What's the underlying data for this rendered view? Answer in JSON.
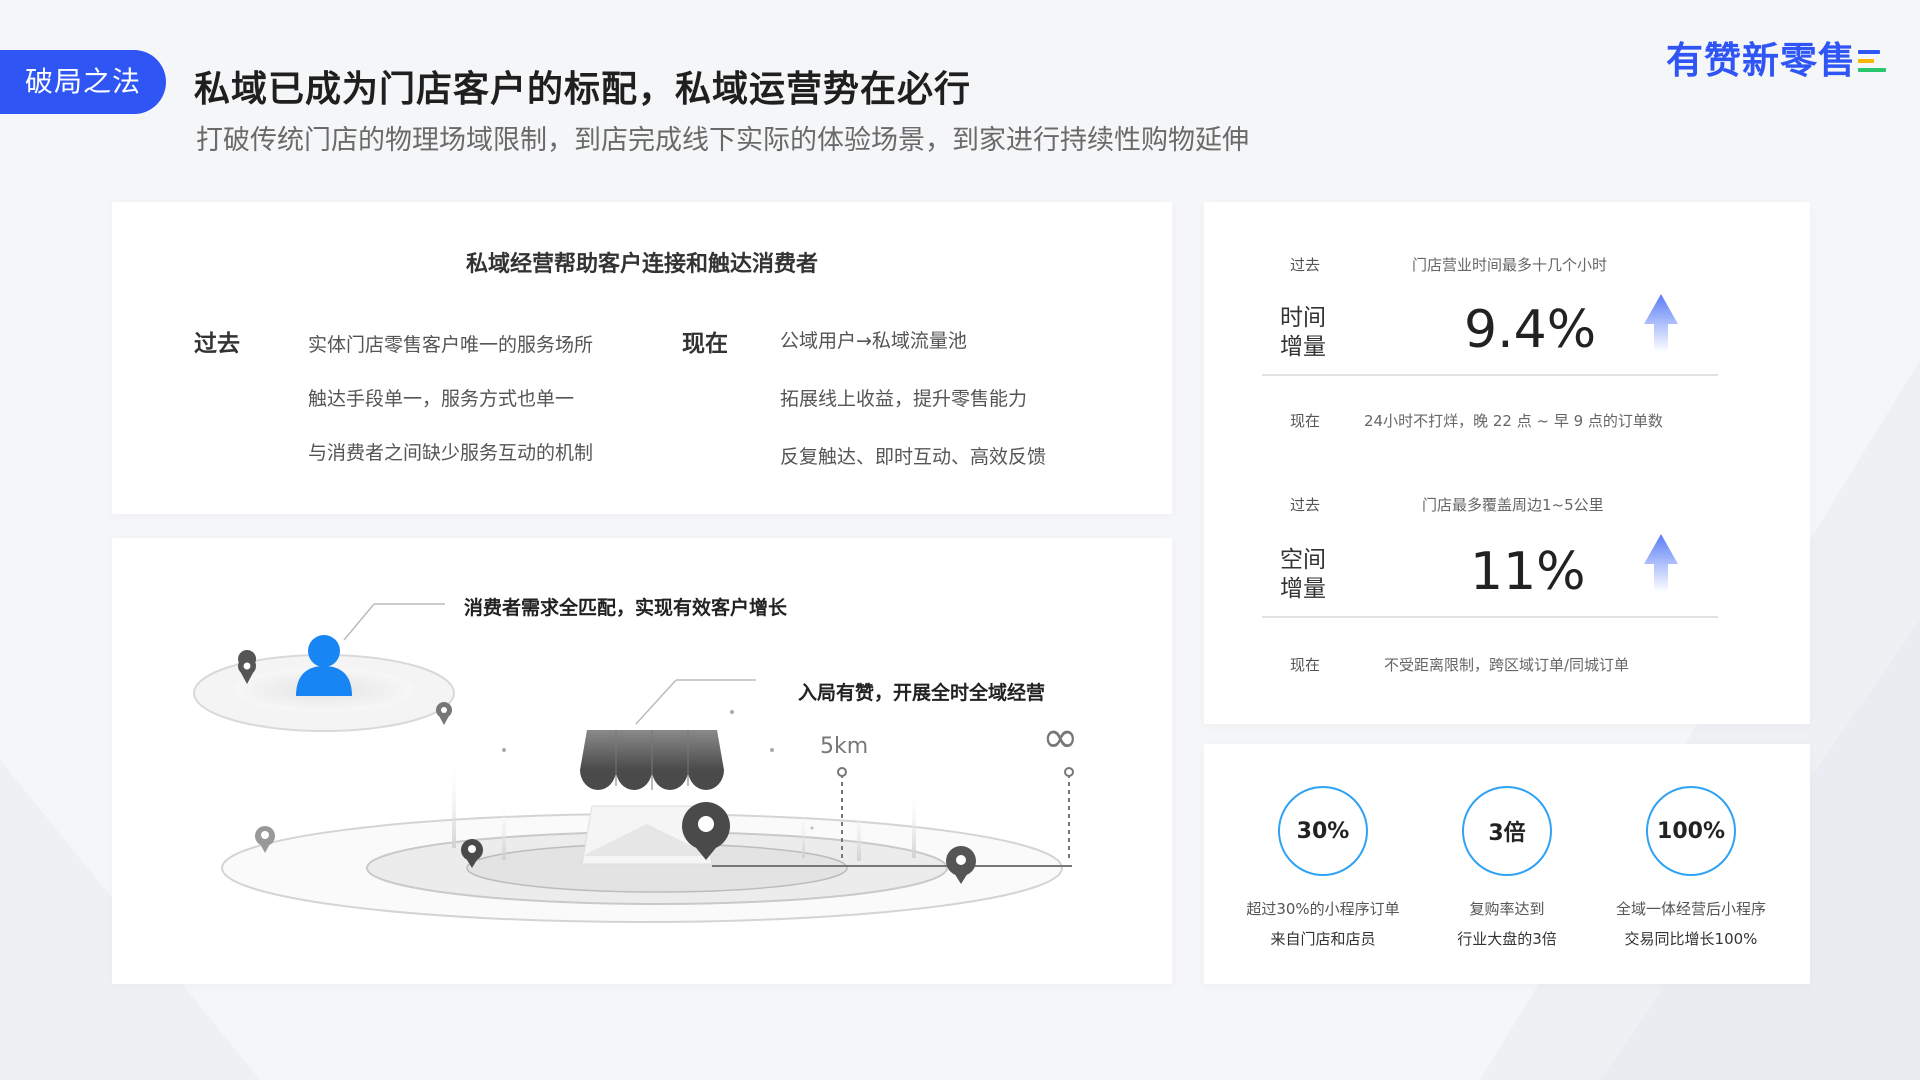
{
  "header": {
    "tag": "破局之法",
    "title": "私域已成为门店客户的标配，私域运营势在必行",
    "subtitle": "打破传统门店的物理场域限制，到店完成线下实际的体验场景，到家进行持续性购物延伸",
    "brand": "有赞新零售"
  },
  "colors": {
    "accent": "#2f56f5",
    "ring": "#2ea2f5",
    "brand_bars": [
      "#2f56f5",
      "#f7b500",
      "#28c76f"
    ]
  },
  "connect_card": {
    "heading": "私域经营帮助客户连接和触达消费者",
    "past_label": "过去",
    "past_items": [
      "实体门店零售客户唯一的服务场所",
      "触达手段单一，服务方式也单一",
      "与消费者之间缺少服务互动的机制"
    ],
    "now_label": "现在",
    "now_items": [
      "公域用户→私域流量池",
      "拓展线上收益，提升零售能力",
      "反复触达、即时互动、高效反馈"
    ]
  },
  "map_card": {
    "label_consumer": "消费者需求全匹配，实现有效客户增长",
    "label_store": "入局有赞，开展全时全域经营",
    "distance": "5km",
    "infinity": "∞"
  },
  "metrics": [
    {
      "past_tag": "过去",
      "past_text": "门店营业时间最多十几个小时",
      "name": "时间增量",
      "value": "9.4%",
      "now_tag": "现在",
      "now_text": "24小时不打烊，晚 22 点 ~ 早 9 点的订单数",
      "icon": "arrow-up-icon"
    },
    {
      "past_tag": "过去",
      "past_text": "门店最多覆盖周边1~5公里",
      "name": "空间增量",
      "value": "11%",
      "now_tag": "现在",
      "now_text": "不受距离限制，跨区域订单/同城订单",
      "icon": "arrow-up-icon"
    }
  ],
  "stats": [
    {
      "value": "30%",
      "line1": "超过30%的小程序订单",
      "line2": "来自门店和店员"
    },
    {
      "value": "3倍",
      "line1": "复购率达到",
      "line2": "行业大盘的3倍"
    },
    {
      "value": "100%",
      "line1": "全域一体经营后小程序",
      "line2": "交易同比增长100%"
    }
  ]
}
